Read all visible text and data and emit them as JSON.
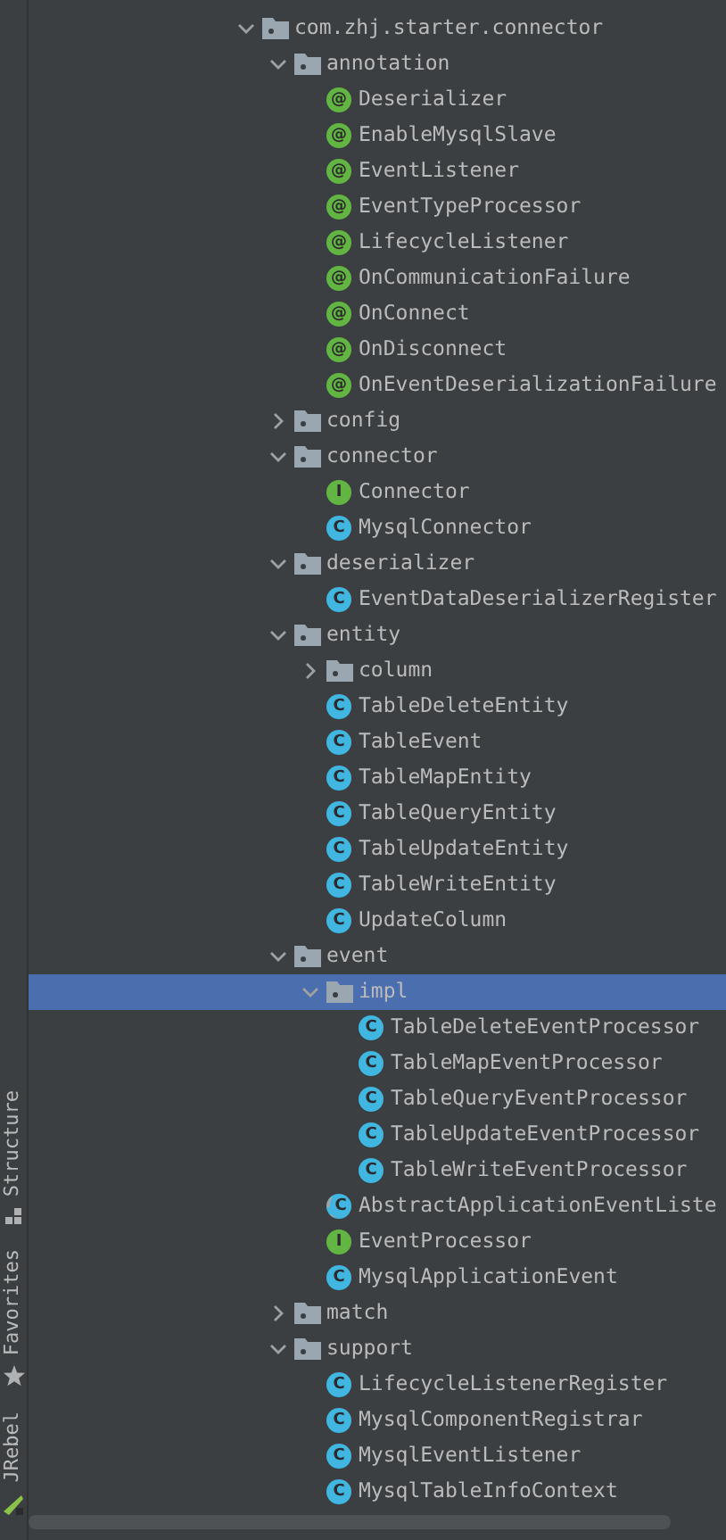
{
  "side_tools": [
    {
      "label": "Structure",
      "kind": "structure"
    },
    {
      "label": "Favorites",
      "kind": "favorites"
    },
    {
      "label": "JRebel",
      "kind": "jrebel"
    }
  ],
  "tree": [
    {
      "label": "com.zhj.starter.connector",
      "kind": "package",
      "expanded": true,
      "selected": false,
      "children": [
        {
          "label": "annotation",
          "kind": "package",
          "expanded": true,
          "selected": false,
          "children": [
            {
              "label": "Deserializer",
              "kind": "annotation",
              "badge": "@",
              "selected": false
            },
            {
              "label": "EnableMysqlSlave",
              "kind": "annotation",
              "badge": "@",
              "selected": false
            },
            {
              "label": "EventListener",
              "kind": "annotation",
              "badge": "@",
              "selected": false
            },
            {
              "label": "EventTypeProcessor",
              "kind": "annotation",
              "badge": "@",
              "selected": false
            },
            {
              "label": "LifecycleListener",
              "kind": "annotation",
              "badge": "@",
              "selected": false
            },
            {
              "label": "OnCommunicationFailure",
              "kind": "annotation",
              "badge": "@",
              "selected": false
            },
            {
              "label": "OnConnect",
              "kind": "annotation",
              "badge": "@",
              "selected": false
            },
            {
              "label": "OnDisconnect",
              "kind": "annotation",
              "badge": "@",
              "selected": false
            },
            {
              "label": "OnEventDeserializationFailure",
              "kind": "annotation",
              "badge": "@",
              "selected": false
            }
          ]
        },
        {
          "label": "config",
          "kind": "package",
          "expanded": false,
          "selected": false
        },
        {
          "label": "connector",
          "kind": "package",
          "expanded": true,
          "selected": false,
          "children": [
            {
              "label": "Connector",
              "kind": "interface",
              "badge": "I",
              "selected": false
            },
            {
              "label": "MysqlConnector",
              "kind": "class",
              "badge": "C",
              "selected": false
            }
          ]
        },
        {
          "label": "deserializer",
          "kind": "package",
          "expanded": true,
          "selected": false,
          "children": [
            {
              "label": "EventDataDeserializerRegister",
              "kind": "class",
              "badge": "C",
              "selected": false
            }
          ]
        },
        {
          "label": "entity",
          "kind": "package",
          "expanded": true,
          "selected": false,
          "children": [
            {
              "label": "column",
              "kind": "package",
              "expanded": false,
              "selected": false
            },
            {
              "label": "TableDeleteEntity",
              "kind": "class",
              "badge": "C",
              "selected": false
            },
            {
              "label": "TableEvent",
              "kind": "class",
              "badge": "C",
              "selected": false
            },
            {
              "label": "TableMapEntity",
              "kind": "class",
              "badge": "C",
              "selected": false
            },
            {
              "label": "TableQueryEntity",
              "kind": "class",
              "badge": "C",
              "selected": false
            },
            {
              "label": "TableUpdateEntity",
              "kind": "class",
              "badge": "C",
              "selected": false
            },
            {
              "label": "TableWriteEntity",
              "kind": "class",
              "badge": "C",
              "selected": false
            },
            {
              "label": "UpdateColumn",
              "kind": "class",
              "badge": "C",
              "selected": false
            }
          ]
        },
        {
          "label": "event",
          "kind": "package",
          "expanded": true,
          "selected": false,
          "children": [
            {
              "label": "impl",
              "kind": "package",
              "expanded": true,
              "selected": true,
              "children": [
                {
                  "label": "TableDeleteEventProcessor",
                  "kind": "class",
                  "badge": "C",
                  "selected": false
                },
                {
                  "label": "TableMapEventProcessor",
                  "kind": "class",
                  "badge": "C",
                  "selected": false
                },
                {
                  "label": "TableQueryEventProcessor",
                  "kind": "class",
                  "badge": "C",
                  "selected": false
                },
                {
                  "label": "TableUpdateEventProcessor",
                  "kind": "class",
                  "badge": "C",
                  "selected": false
                },
                {
                  "label": "TableWriteEventProcessor",
                  "kind": "class",
                  "badge": "C",
                  "selected": false
                }
              ]
            },
            {
              "label": "AbstractApplicationEventListe",
              "kind": "abstract",
              "badge": "C",
              "selected": false
            },
            {
              "label": "EventProcessor",
              "kind": "interface",
              "badge": "I",
              "selected": false
            },
            {
              "label": "MysqlApplicationEvent",
              "kind": "class",
              "badge": "C",
              "selected": false
            }
          ]
        },
        {
          "label": "match",
          "kind": "package",
          "expanded": false,
          "selected": false
        },
        {
          "label": "support",
          "kind": "package",
          "expanded": true,
          "selected": false,
          "children": [
            {
              "label": "LifecycleListenerRegister",
              "kind": "class",
              "badge": "C",
              "selected": false
            },
            {
              "label": "MysqlComponentRegistrar",
              "kind": "class",
              "badge": "C",
              "selected": false
            },
            {
              "label": "MysqlEventListener",
              "kind": "class",
              "badge": "C",
              "selected": false
            },
            {
              "label": "MysqlTableInfoContext",
              "kind": "class",
              "badge": "C",
              "selected": false
            }
          ]
        }
      ]
    }
  ]
}
